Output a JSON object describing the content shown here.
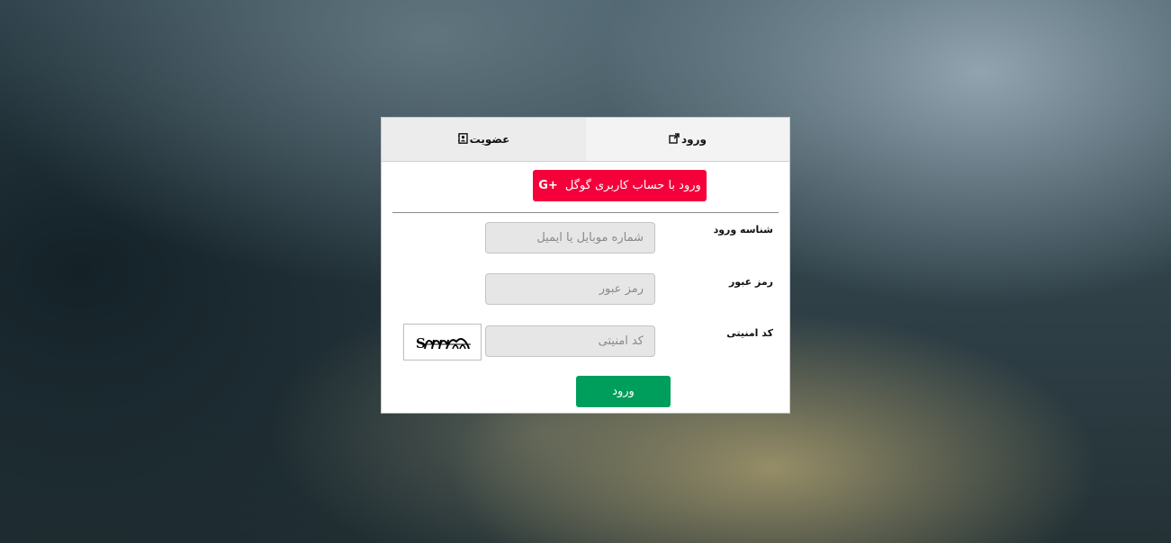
{
  "tabs": {
    "login_label": "ورود",
    "register_label": "عضویت"
  },
  "google_button": {
    "label": "ورود با حساب کاربری گوگل",
    "icon_text": "G+"
  },
  "fields": {
    "login_id": {
      "label": "شناسه ورود",
      "placeholder": "شماره موبایل یا ایمیل"
    },
    "password": {
      "label": "رمز عبور",
      "placeholder": "رمز عبور"
    },
    "captcha": {
      "label": "کد امنیتی",
      "placeholder": "کد امنیتی"
    }
  },
  "submit_label": "ورود",
  "colors": {
    "google": "#f5003a",
    "submit": "#009e5c"
  },
  "icons": {
    "login_tab": "external-link-icon",
    "register_tab": "address-book-icon"
  }
}
